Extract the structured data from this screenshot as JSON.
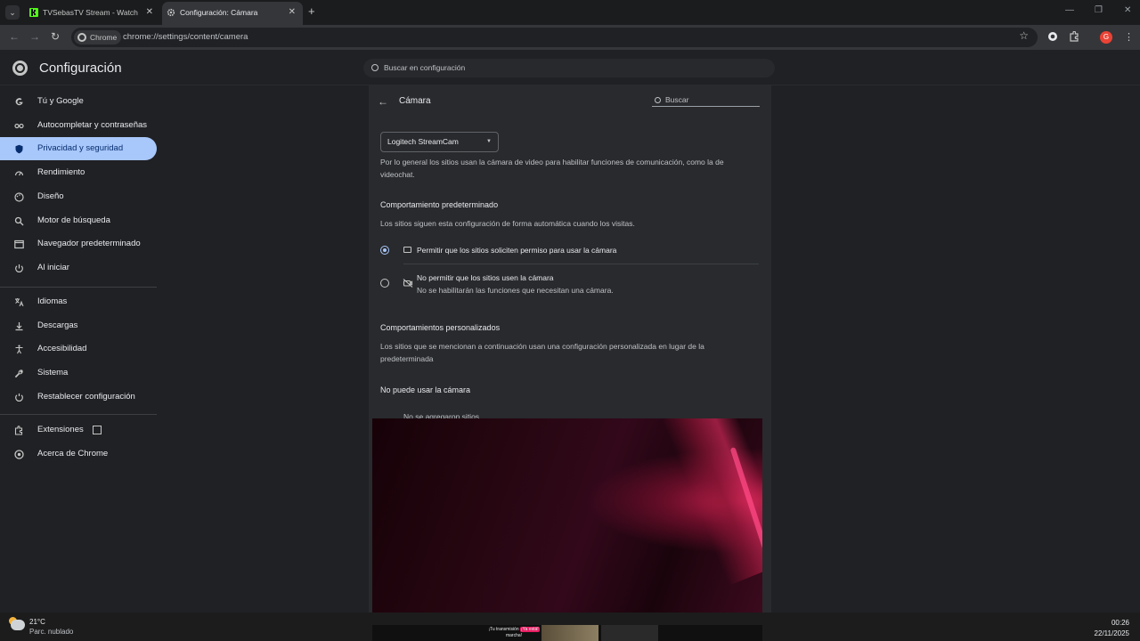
{
  "browser": {
    "tabs": [
      {
        "title": "TVSebasTV Stream - Watch Live",
        "active": false
      },
      {
        "title": "Configuración: Cámara",
        "active": true
      }
    ],
    "chip_label": "Chrome",
    "url": "chrome://settings/content/camera",
    "avatar_letter": "G"
  },
  "header": {
    "title": "Configuración",
    "search_placeholder": "Buscar en configuración"
  },
  "sidebar": {
    "items": [
      {
        "label": "Tú y Google",
        "icon": "google-icon"
      },
      {
        "label": "Autocompletar y contraseñas",
        "icon": "key-icon"
      },
      {
        "label": "Privacidad y seguridad",
        "icon": "shield-icon",
        "active": true
      },
      {
        "label": "Rendimiento",
        "icon": "speedometer-icon"
      },
      {
        "label": "Diseño",
        "icon": "palette-icon"
      },
      {
        "label": "Motor de búsqueda",
        "icon": "search-icon"
      },
      {
        "label": "Navegador predeterminado",
        "icon": "browser-icon"
      },
      {
        "label": "Al iniciar",
        "icon": "power-icon"
      },
      {
        "label": "Idiomas",
        "icon": "translate-icon"
      },
      {
        "label": "Descargas",
        "icon": "download-icon"
      },
      {
        "label": "Accesibilidad",
        "icon": "accessibility-icon"
      },
      {
        "label": "Sistema",
        "icon": "wrench-icon"
      },
      {
        "label": "Restablecer configuración",
        "icon": "reset-icon"
      },
      {
        "label": "Extensiones",
        "icon": "puzzle-icon"
      },
      {
        "label": "Acerca de Chrome",
        "icon": "chrome-icon"
      }
    ]
  },
  "camera_page": {
    "title": "Cámara",
    "search_placeholder": "Buscar",
    "device": "Logitech StreamCam",
    "intro": "Por lo general los sitios usan la cámara de video para habilitar funciones de comunicación, como la de videochat.",
    "default_heading": "Comportamiento predeterminado",
    "default_desc": "Los sitios siguen esta configuración de forma automática cuando los visitas.",
    "option_allow": "Permitir que los sitios soliciten permiso para usar la cámara",
    "option_block": "No permitir que los sitios usen la cámara",
    "option_block_sub": "No se habilitarán las funciones que necesitan una cámara.",
    "custom_heading": "Comportamientos personalizados",
    "custom_desc": "Los sitios que se mencionan a continuación usan una configuración personalizada en lugar de la predeterminada",
    "blocked_heading": "No puede usar la cámara",
    "no_sites": "No se agregaron sitios"
  },
  "stream_overlay": {
    "note_line1": "¡Tu transmisión",
    "note_badge": "¡Ya está!",
    "note_line2": "marcha!"
  },
  "taskbar": {
    "temperature": "21°C",
    "weather": "Parc. nublado",
    "time": "00:26",
    "date": "22/11/2025"
  },
  "colors": {
    "accent": "#a8c7fa",
    "background": "#202124",
    "panel": "#292a2d"
  }
}
